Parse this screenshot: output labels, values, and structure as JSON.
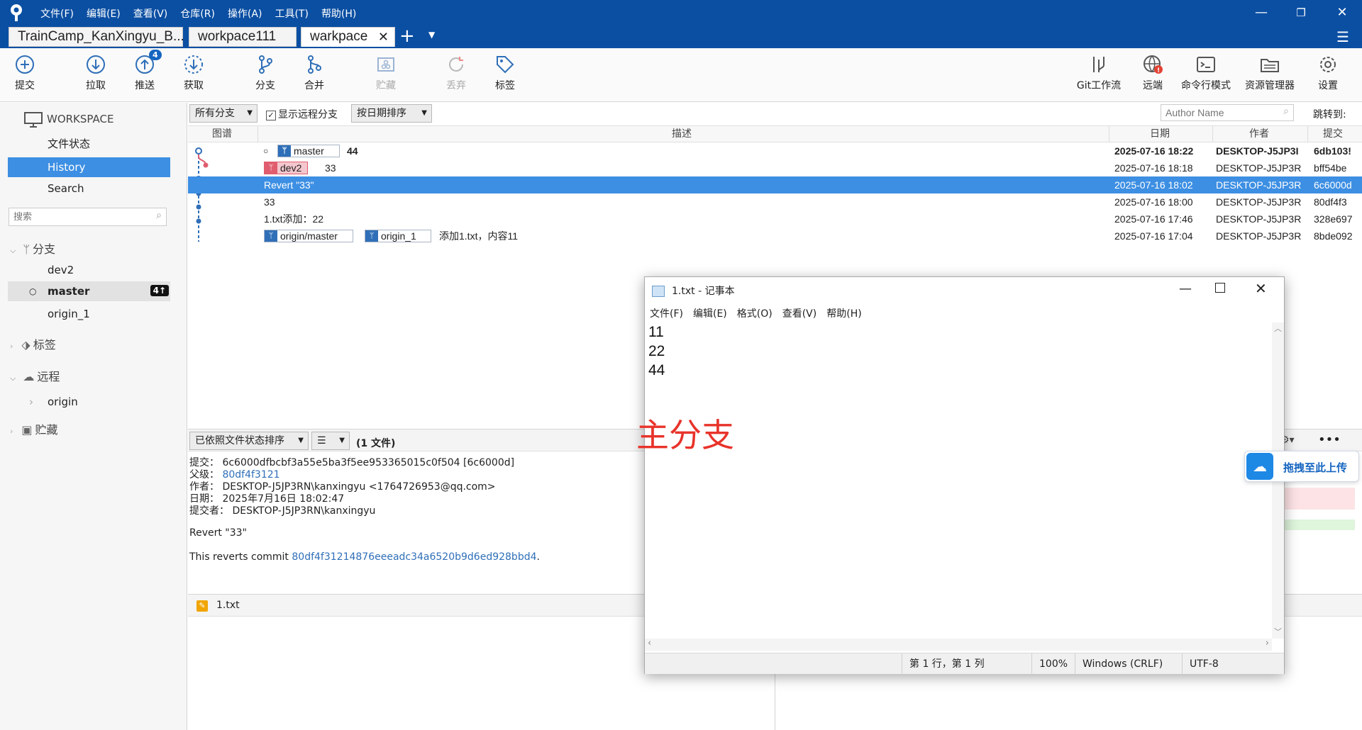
{
  "menu": [
    "文件(F)",
    "编辑(E)",
    "查看(V)",
    "仓库(R)",
    "操作(A)",
    "工具(T)",
    "帮助(H)"
  ],
  "tabs": [
    {
      "label": "TrainCamp_KanXingyu_B..."
    },
    {
      "label": "workpace111"
    },
    {
      "label": "warkpace"
    }
  ],
  "toolbar": {
    "commit": "提交",
    "pull": "拉取",
    "push": "推送",
    "push_badge": "4",
    "fetch": "获取",
    "branch": "分支",
    "merge": "合并",
    "stash": "贮藏",
    "discard": "丢弃",
    "tag": "标签",
    "gitflow": "Git工作流",
    "remote": "远端",
    "terminal": "命令行模式",
    "explorer": "资源管理器",
    "settings": "设置"
  },
  "sidebar": {
    "workspace": "WORKSPACE",
    "file_status": "文件状态",
    "history": "History",
    "search": "Search",
    "search_placeholder": "搜索",
    "branches_title": "分支",
    "branches": [
      "dev2",
      "master",
      "origin_1"
    ],
    "master_badge": "4↑",
    "tags_title": "标签",
    "remotes_title": "远程",
    "remotes": [
      "origin"
    ],
    "stashes_title": "贮藏"
  },
  "filters": {
    "branch_filter": "所有分支",
    "show_remote": "显示远程分支",
    "sort": "按日期排序",
    "author_placeholder": "Author Name",
    "jump_to": "跳转到:"
  },
  "columns": {
    "graph": "图谱",
    "desc": "描述",
    "date": "日期",
    "author": "作者",
    "commit": "提交"
  },
  "commits": [
    {
      "refs": [
        "master"
      ],
      "desc": "44",
      "date": "2025-07-16 18:22",
      "author": "DESKTOP-J5JP3I",
      "hash": "6db103!"
    },
    {
      "refs": [
        "dev2"
      ],
      "desc": "33",
      "date": "2025-07-16 18:18",
      "author": "DESKTOP-J5JP3R",
      "hash": "bff54be"
    },
    {
      "refs": [],
      "desc": "Revert \"33\"",
      "date": "2025-07-16 18:02",
      "author": "DESKTOP-J5JP3R",
      "hash": "6c6000d"
    },
    {
      "refs": [],
      "desc": "33",
      "date": "2025-07-16 18:00",
      "author": "DESKTOP-J5JP3R",
      "hash": "80df4f3"
    },
    {
      "refs": [],
      "desc": "1.txt添加：22",
      "date": "2025-07-16 17:46",
      "author": "DESKTOP-J5JP3R",
      "hash": "328e697"
    },
    {
      "refs": [
        "origin/master",
        "origin_1"
      ],
      "desc": "添加1.txt，内容11",
      "date": "2025-07-16 17:04",
      "author": "DESKTOP-J5JP3R",
      "hash": "8bde092"
    }
  ],
  "detail": {
    "sort_files": "已依照文件状态排序",
    "file_count": "(1 文件)",
    "commit_label": "提交：",
    "commit_value": "6c6000dfbcbf3a55e5ba3f5ee953365015c0f504 [6c6000d]",
    "parent_label": "父级：",
    "parent_value": "80df4f3121",
    "author_label": "作者：",
    "author_value": "DESKTOP-J5JP3RN\\kanxingyu <1764726953@qq.com>",
    "date_label": "日期：",
    "date_value": "2025年7月16日 18:02:47",
    "committer_label": "提交者：",
    "committer_value": "DESKTOP-J5JP3RN\\kanxingyu",
    "message": "Revert \"33\"",
    "reverts_prefix": "This reverts commit ",
    "reverts_hash": "80df4f31214876eeeadc34a6520b9d6ed928bbd4",
    "reverts_suffix": ".",
    "file_name": "1.txt"
  },
  "notepad": {
    "title": "1.txt - 记事本",
    "menu": [
      "文件(F)",
      "编辑(E)",
      "格式(O)",
      "查看(V)",
      "帮助(H)"
    ],
    "lines": [
      "11",
      "22",
      "44"
    ],
    "status_pos": "第 1 行，第 1 列",
    "status_zoom": "100%",
    "status_eol": "Windows (CRLF)",
    "status_enc": "UTF-8"
  },
  "annotation": "主分支",
  "upload_widget": "拖拽至此上传",
  "colors": {
    "accent": "#0b4fa3",
    "selection": "#3d8fe3",
    "annotation": "#e8332a",
    "ref_bg": "#2f6fb8"
  }
}
